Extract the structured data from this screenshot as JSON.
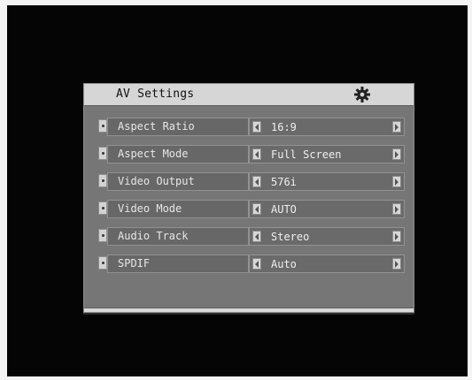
{
  "panel": {
    "title": "AV Settings",
    "header_icon": "gear-icon",
    "rows": [
      {
        "label": "Aspect Ratio",
        "value": "16:9"
      },
      {
        "label": "Aspect Mode",
        "value": "Full Screen"
      },
      {
        "label": "Video Output",
        "value": "576i"
      },
      {
        "label": "Video Mode",
        "value": "AUTO"
      },
      {
        "label": "Audio Track",
        "value": "Stereo"
      },
      {
        "label": "SPDIF",
        "value": "Auto"
      }
    ]
  },
  "colors": {
    "screen_background": "#050505",
    "panel_background": "#767676",
    "header_background": "#d6d6d6",
    "row_background": "#6a6a6a",
    "text_color": "#e7e7e7"
  }
}
